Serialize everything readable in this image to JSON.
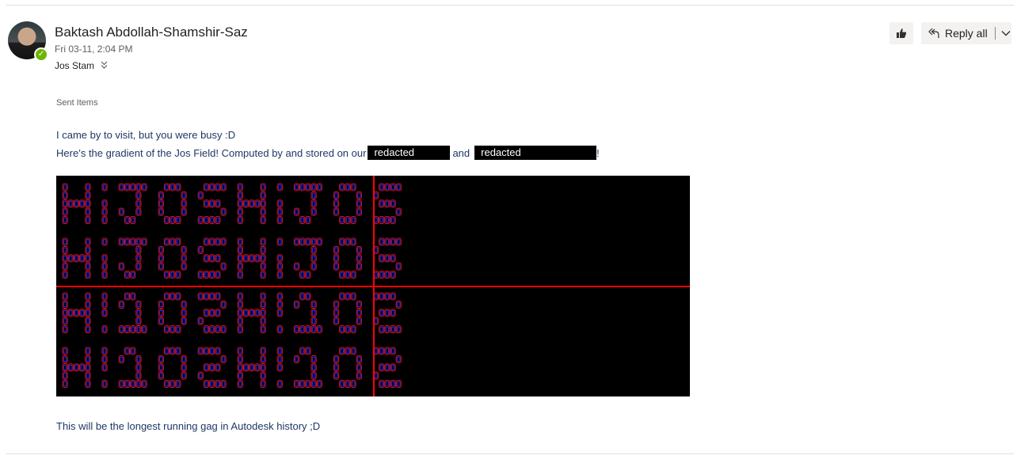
{
  "message": {
    "sender": "Baktash Abdollah-Shamshir-Saz",
    "date": "Fri 03-11, 2:04 PM",
    "to": "Jos Stam",
    "folder": "Sent Items"
  },
  "toolbar": {
    "like_icon": "thumbs-up-icon",
    "reply_all_label": "Reply all",
    "reply_icon": "reply-all-icon",
    "more_icon": "chevron-down-icon"
  },
  "body": {
    "line1": "I came by to visit, but you were busy :D",
    "line2_prefix": "Here’s the gradient of the Jos Field! Computed by and stored on our",
    "redacted_1": "redacted",
    "line2_middle": "and",
    "redacted_2": "redacted",
    "line2_suffix": "!",
    "line3": "This will be the longest running gag in Autodesk history ;D"
  },
  "image": {
    "description_icon": "gradient-field-image",
    "colors": {
      "background": "#000000",
      "outline_a": "#cc1111",
      "outline_b": "#2a2aff",
      "axis": "#ff0000"
    }
  },
  "colors": {
    "body_text": "#1f3864",
    "presence": "#6bb700"
  }
}
